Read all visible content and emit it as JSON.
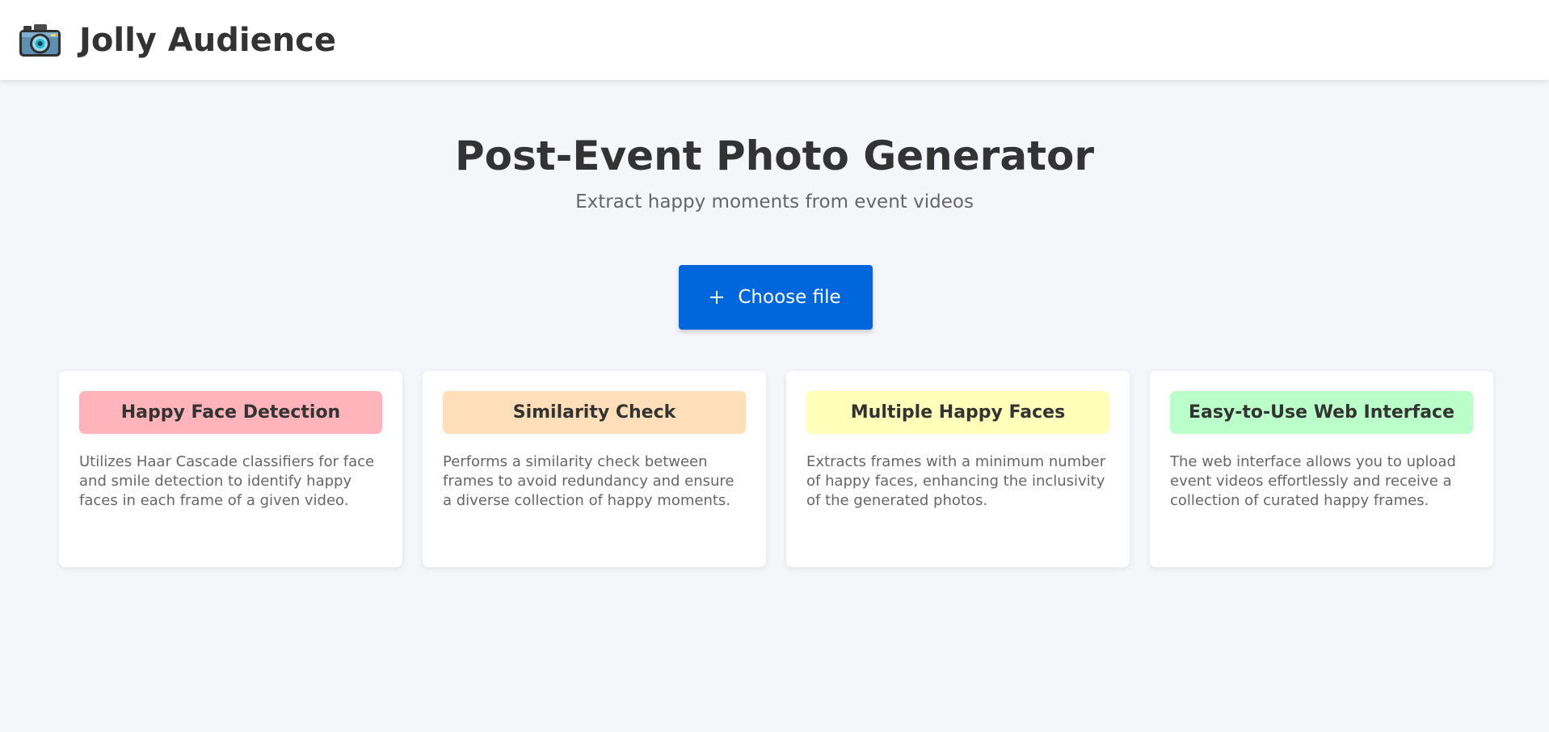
{
  "header": {
    "logo_icon": "camera-icon",
    "title": "Jolly Audience"
  },
  "hero": {
    "title": "Post-Event Photo Generator",
    "subtitle": "Extract happy moments from event videos"
  },
  "upload": {
    "icon": "plus-icon",
    "label": "Choose file",
    "color": "#0066dd"
  },
  "features": [
    {
      "title": "Happy Face Detection",
      "description": "Utilizes Haar Cascade classifiers for face and smile detection to identify happy faces in each frame of a given video.",
      "color": "#ffb3ba"
    },
    {
      "title": "Similarity Check",
      "description": "Performs a similarity check between frames to avoid redundancy and ensure a diverse collection of happy moments.",
      "color": "#ffdfba"
    },
    {
      "title": "Multiple Happy Faces",
      "description": "Extracts frames with a minimum number of happy faces, enhancing the inclusivity of the generated photos.",
      "color": "#ffffba"
    },
    {
      "title": "Easy-to-Use Web Interface",
      "description": "The web interface allows you to upload event videos effortlessly and receive a collection of curated happy frames.",
      "color": "#baffc9"
    }
  ]
}
